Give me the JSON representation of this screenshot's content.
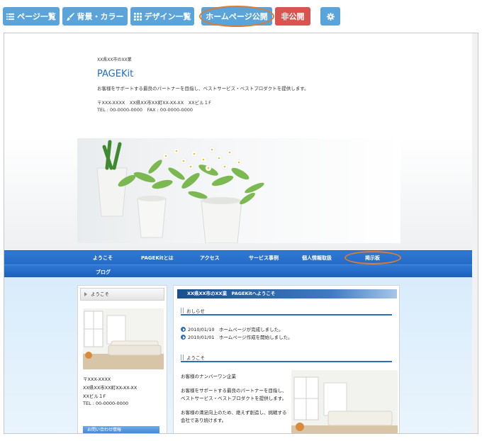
{
  "toolbar": {
    "page_list_label": "ページ一覧",
    "background_color_label": "背景・カラー",
    "design_list_label": "デザイン一覧",
    "publish_label": "ホームページ公開",
    "unpublish_label": "非公開"
  },
  "site": {
    "tagline": "XX県XX市のXX業",
    "logo": "PAGEKit",
    "description": "お客様をサポートする最良のパートナーを目指し、ベストサービス・ベストプロダクトを提供します。",
    "address": "〒XXX-XXXX　XX県XX市XX町XX-XX-XX　XXビル１F",
    "tel_fax": "TEL : 00-0000-0000　FAX : 00-0000-0000"
  },
  "nav": {
    "items": [
      "ようこそ",
      "PAGEKitとは",
      "アクセス",
      "サービス事例",
      "個人情報取扱",
      "掲示板",
      "ブログ"
    ]
  },
  "sidebar": {
    "heading": "ようこそ",
    "postal": "〒XXX-XXXX",
    "address1": "XX県XX市XX町XX-XX-XX",
    "address2": "XXビル１F",
    "tel": "TEL : 00-0000-0000",
    "contact_button": "お問い合わせ情報"
  },
  "main": {
    "title": "XX県XX市のXX業　PAGEKitへようこそ",
    "news_heading": "おしらせ",
    "news": [
      {
        "date": "2010/01/10",
        "text": "ホームページが完成しました。"
      },
      {
        "date": "2010/01/01",
        "text": "ホームページ作成を開始しました。"
      }
    ],
    "welcome_heading": "ようこそ",
    "welcome_lines": [
      "お客様のナンバーワン企業",
      "お客様をサポートする最良のパートナーを目指し、",
      "ベストサービス・ベストプロダクトを提供します。",
      "お客様の満足向上のため、絶えず創造し、挑戦する",
      "会社であり続けます。"
    ]
  },
  "colors": {
    "toolbar_blue": "#5ba4d9",
    "unpublish_red": "#d9534f",
    "highlight_orange": "#e07a2e",
    "nav_blue": "#1f66c1",
    "logo_blue": "#1f6ec4"
  },
  "icons": {
    "page_list": "list-icon",
    "background_color": "brush-icon",
    "design_list": "grid-icon",
    "settings": "gear-icon"
  }
}
